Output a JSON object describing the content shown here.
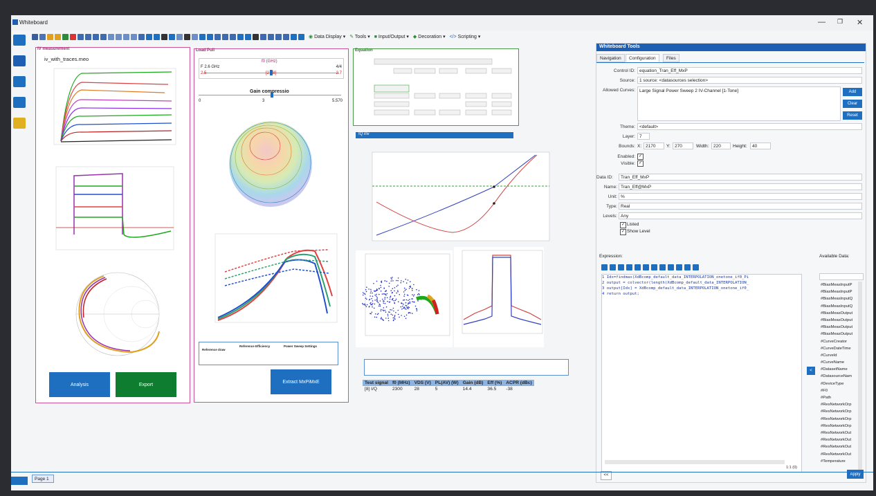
{
  "window": {
    "title": "Whiteboard"
  },
  "menus": [
    "Data Display",
    "Tools",
    "Input/Output",
    "Decoration",
    "Scripting"
  ],
  "panels": {
    "iv": {
      "title": "IV measurement",
      "filename": "iv_with_traces.meo",
      "analysis_label": "Analysis",
      "export_label": "Export"
    },
    "loadpull": {
      "title": "Load Pull",
      "f0_label": "f0 (GHz)",
      "f0_value": "F 2.6 GHz",
      "f0_min": "2.5",
      "f0_mid": "[2 / 8]",
      "f0_max": "2.7",
      "f0_right": "4/4",
      "gc_label": "Gain compressio",
      "gc_min": "0",
      "gc_mid": "3",
      "gc_max": "5.570",
      "legend_headers": [
        "Reference draw",
        "Reference Efficiency",
        "Power Sweep Settings"
      ],
      "extract_label": "Extract MxPiMxE"
    },
    "equation": {
      "title": "Equation"
    },
    "iq": {
      "title": "IQ inv"
    }
  },
  "results": {
    "headers": [
      "Test signal",
      "f0 (MHz)",
      "VDS (V)",
      "PL(AV) (W)",
      "Gain (dB)",
      "Eff (%)",
      "ACPR (dBc)"
    ],
    "row": [
      "[8] I/Q",
      "2300",
      "28",
      "5",
      "14.4",
      "36.5",
      "-38"
    ]
  },
  "dock": {
    "title": "Whiteboard Tools",
    "tabs": [
      "Navigation",
      "Configuration",
      "Files"
    ],
    "control_id_label": "Control ID:",
    "control_id": "equation_Tran_Eff_MxP",
    "source_label": "Source:",
    "source": "1 source: <datasources selection>",
    "allowed_label": "Allowed Curves:",
    "allowed": "Large Signal Power Sweep 2 IV-Channel [1-Tone]",
    "add_label": "Add",
    "clear_label": "Clear",
    "reset_label": "Reset",
    "theme_label": "Theme:",
    "theme": "<default>",
    "layer_label": "Layer:",
    "layer": "7",
    "bounds_label": "Bounds:",
    "x_label": "X:",
    "x": "2170",
    "y_label": "Y:",
    "y": "270",
    "width_label": "Width:",
    "width": "220",
    "height_label": "Height:",
    "height": "40",
    "enabled_label": "Enabled:",
    "visible_label": "Visible:",
    "dataid_label": "Data ID:",
    "dataid": "Tran_Eff_MxP",
    "name_label": "Name:",
    "name": "Tran_Eff@MxP",
    "unit_label": "Unit:",
    "unit": "%",
    "type_label": "Type:",
    "type": "Real",
    "levels_label": "Levels:",
    "levels": "Any",
    "listed_label": "Listed",
    "showlevel_label": "Show Level",
    "expression_label": "Expression:",
    "code": [
      "1 Idx=findmax(XdBcomp_default_data_INTERPOLATION_onetone_if0_Pi",
      "2 output = colvector(length(XdBcomp_default_data_INTERPOLATION_",
      "3 output[Idx] = XdBcomp_default_data_INTERPOLATION_onetone_if0_",
      "4 return output;"
    ],
    "cursor_pos": "1:1 (0)",
    "available_label": "Available Data:",
    "available": [
      "#BiasMeasInputP",
      "#BiasMeasInputP",
      "#BiasMeasInputQ",
      "#BiasMeasInputQ",
      "#BiasMeasOutput",
      "#BiasMeasOutput",
      "#BiasMeasOutput",
      "#BiasMeasOutput",
      "#CurveCreator",
      "#CurveDateTime",
      "#CurveId",
      "#CurveName",
      "#DatasetName",
      "#DatasourceNam",
      "#DeviceType",
      "#F0",
      "#Path",
      "#ResNetworkOrp",
      "#ResNetworkOrp",
      "#ResNetworkOrp",
      "#ResNetworkOrp",
      "#ResNetworkOut",
      "#ResNetworkOut",
      "#ResNetworkOut",
      "#ResNetworkOut",
      "#Temperature"
    ],
    "apply_label": "Apply",
    "collapse_label": "<<"
  },
  "statusbar": {
    "page_tab": "Page 1"
  },
  "colors": {
    "accent": "#1f6fc1",
    "panel_border_pink": "#c9549a",
    "panel_border_green": "#4a9a4a"
  }
}
